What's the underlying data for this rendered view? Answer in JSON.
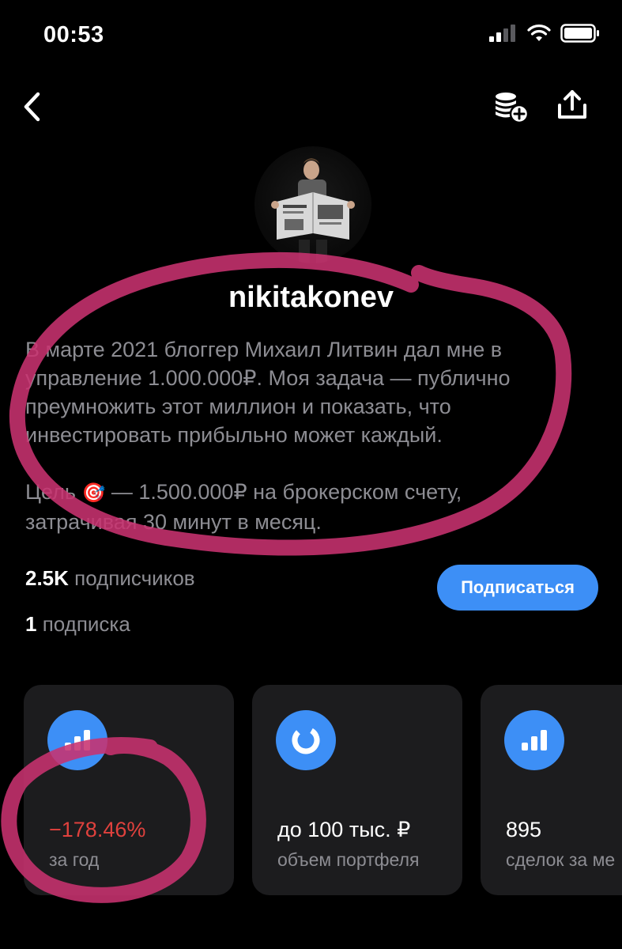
{
  "status_bar": {
    "time": "00:53"
  },
  "profile": {
    "username": "nikitakonev",
    "bio_paragraph_1": "В марте 2021 блоггер Михаил Литвин дал мне в\nуправление 1.000.000₽. Моя задача — публично\nпреумножить этот миллион и показать, что\nинвестировать прибыльно может каждый.",
    "goal_prefix": "Цель",
    "goal_emoji": "🎯",
    "goal_text": " — 1.500.000₽ на брокерском счету,\nзатрачивая 30 минут в месяц.",
    "followers_count": "2.5K",
    "followers_label": " подписчиков",
    "following_count": "1",
    "following_label": " подписка",
    "subscribe_label": "Подписаться"
  },
  "stats": [
    {
      "icon": "bar-chart-icon",
      "value": "−178.46%",
      "label": "за год",
      "value_color": "#e0413d"
    },
    {
      "icon": "pie-chart-icon",
      "value": "до 100 тыс. ₽",
      "label": "объем портфеля"
    },
    {
      "icon": "bar-chart-icon",
      "value": "895",
      "label": "сделок за ме"
    }
  ],
  "colors": {
    "accent": "#3d8ff6",
    "negative": "#e0413d",
    "annotation": "#c8326f",
    "card": "#1c1c1e"
  }
}
